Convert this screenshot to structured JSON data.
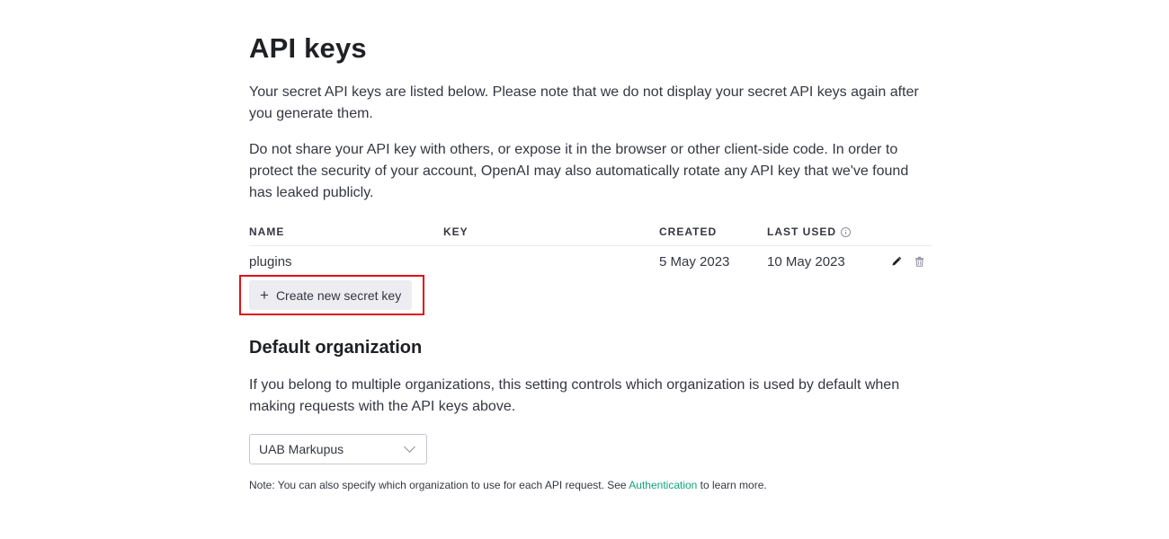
{
  "page": {
    "title": "API keys",
    "intro_1": "Your secret API keys are listed below. Please note that we do not display your secret API keys again after you generate them.",
    "intro_2": "Do not share your API key with others, or expose it in the browser or other client-side code. In order to protect the security of your account, OpenAI may also automatically rotate any API key that we've found has leaked publicly."
  },
  "table": {
    "columns": [
      "NAME",
      "KEY",
      "CREATED",
      "LAST USED"
    ],
    "rows": [
      {
        "name": "plugins",
        "key": "",
        "created": "5 May 2023",
        "last_used": "10 May 2023",
        "actions": [
          "pencil-icon",
          "trash-icon"
        ]
      }
    ]
  },
  "create_button": {
    "icon": "plus-icon",
    "label": "Create new secret key"
  },
  "default_org": {
    "title": "Default organization",
    "description": "If you belong to multiple organizations, this setting controls which organization is used by default when making requests with the API keys above.",
    "selected": "UAB Markupus",
    "note_prefix": "Note: You can also specify which organization to use for each API request. See ",
    "note_link": "Authentication",
    "note_suffix": " to learn more."
  },
  "colors": {
    "highlight": "#e0101a",
    "link": "#10a37f",
    "button_bg": "#ececf1"
  }
}
